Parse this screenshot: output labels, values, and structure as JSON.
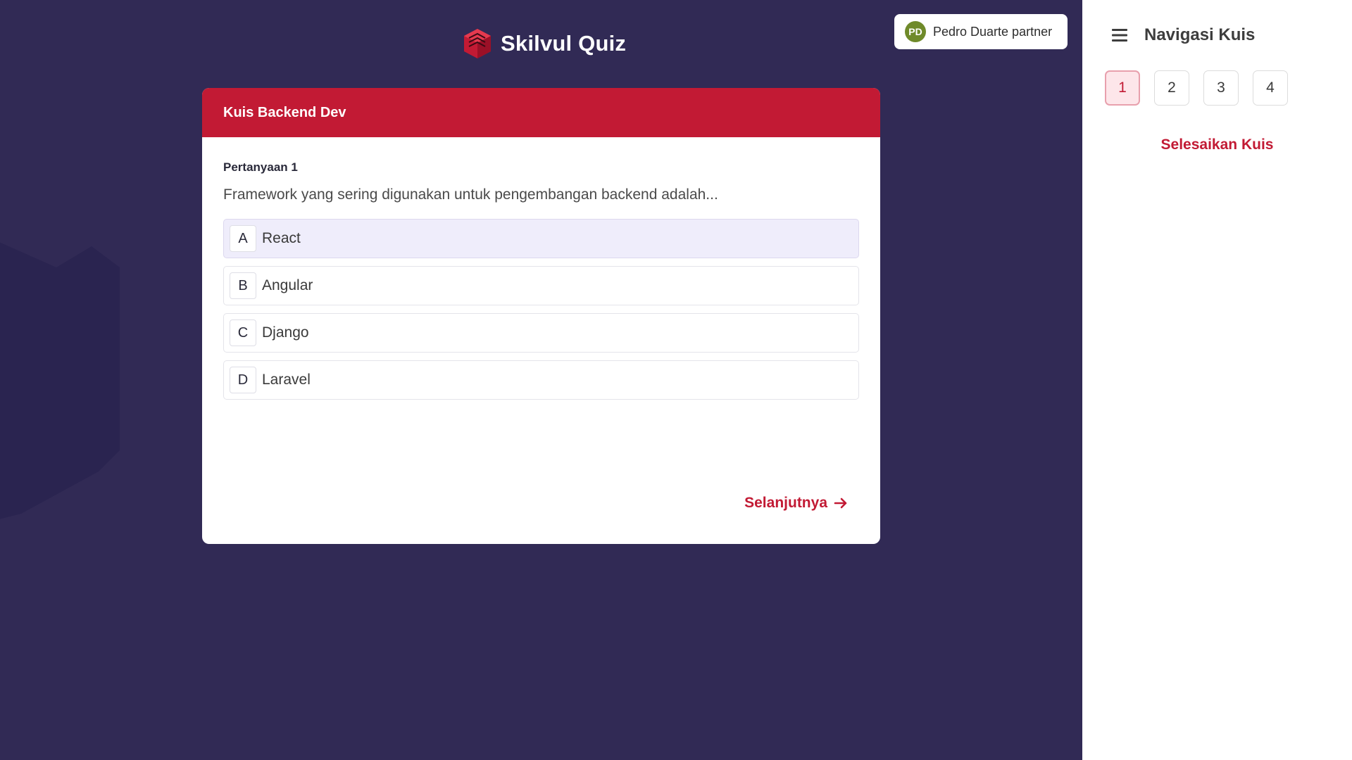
{
  "brand": {
    "name": "Skilvul Quiz",
    "icon": "skilvul-logo-icon"
  },
  "user": {
    "initials": "PD",
    "name": "Pedro Duarte partner",
    "avatar_color": "#6f8a2a"
  },
  "quiz": {
    "title": "Kuis Backend Dev",
    "question_label": "Pertanyaan 1",
    "question_text": "Framework yang sering digunakan untuk pengembangan backend adalah...",
    "selected_option": "A",
    "options": [
      {
        "letter": "A",
        "text": "React"
      },
      {
        "letter": "B",
        "text": "Angular"
      },
      {
        "letter": "C",
        "text": "Django"
      },
      {
        "letter": "D",
        "text": "Laravel"
      }
    ],
    "next_label": "Selanjutnya",
    "next_icon": "arrow-right-icon"
  },
  "sidebar": {
    "menu_icon": "hamburger-menu-icon",
    "title": "Navigasi Kuis",
    "question_numbers": [
      "1",
      "2",
      "3",
      "4"
    ],
    "active_question": "1",
    "finish_label": "Selesaikan Kuis"
  },
  "colors": {
    "background": "#312a55",
    "accent": "#c21a34",
    "selected_option_bg": "#efedfb",
    "active_nav_bg": "#fde6ea"
  }
}
